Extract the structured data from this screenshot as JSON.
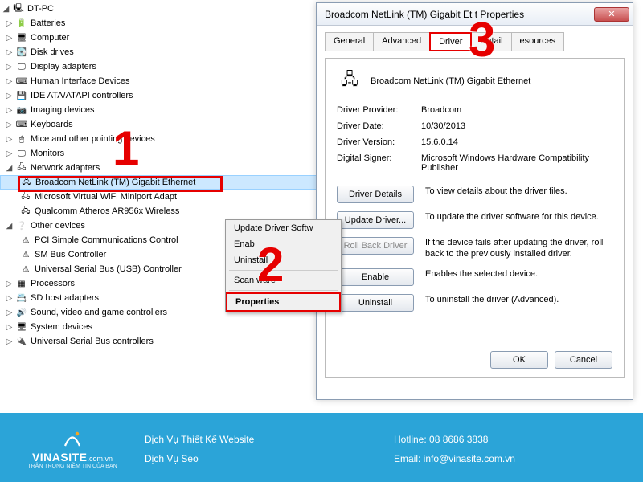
{
  "tree": {
    "root": "DT-PC",
    "items": [
      {
        "icon": "🔋",
        "label": "Batteries"
      },
      {
        "icon": "🖥",
        "label": "Computer"
      },
      {
        "icon": "💽",
        "label": "Disk drives"
      },
      {
        "icon": "🖵",
        "label": "Display adapters"
      },
      {
        "icon": "⌨",
        "label": "Human Interface Devices"
      },
      {
        "icon": "💾",
        "label": "IDE ATA/ATAPI controllers"
      },
      {
        "icon": "📷",
        "label": "Imaging devices"
      },
      {
        "icon": "⌨",
        "label": "Keyboards"
      },
      {
        "icon": "🖱",
        "label": "Mice and other pointing devices"
      },
      {
        "icon": "🖵",
        "label": "Monitors"
      }
    ],
    "network_label": "Network adapters",
    "network_children": [
      "Broadcom NetLink (TM) Gigabit Ethernet",
      "Microsoft Virtual WiFi Miniport Adapt",
      "Qualcomm Atheros AR956x Wireless"
    ],
    "other_label": "Other devices",
    "other_children": [
      "PCI Simple Communications Control",
      "SM Bus Controller",
      "Universal Serial Bus (USB) Controller"
    ],
    "tail": [
      {
        "icon": "▦",
        "label": "Processors"
      },
      {
        "icon": "📇",
        "label": "SD host adapters"
      },
      {
        "icon": "🔊",
        "label": "Sound, video and game controllers"
      },
      {
        "icon": "🖥",
        "label": "System devices"
      },
      {
        "icon": "🔌",
        "label": "Universal Serial Bus controllers"
      }
    ]
  },
  "context_menu": {
    "items": [
      "Update Driver Softw",
      "Enab",
      "Uninstall"
    ],
    "scan": "Scan              ware",
    "properties": "Properties"
  },
  "dialog": {
    "title": "Broadcom NetLink (TM) Gigabit Et          t Properties",
    "tabs": [
      "General",
      "Advanced",
      "Driver",
      "Detail",
      "    esources"
    ],
    "device_name": "Broadcom NetLink (TM) Gigabit Ethernet",
    "info": {
      "provider_label": "Driver Provider:",
      "provider_val": "Broadcom",
      "date_label": "Driver Date:",
      "date_val": "10/30/2013",
      "version_label": "Driver Version:",
      "version_val": "15.6.0.14",
      "signer_label": "Digital Signer:",
      "signer_val": "Microsoft Windows Hardware Compatibility Publisher"
    },
    "buttons": {
      "details": "Driver Details",
      "details_desc": "To view details about the driver files.",
      "update": "Update Driver...",
      "update_desc": "To update the driver software for this device.",
      "rollback": "Roll Back Driver",
      "rollback_desc": "If the device fails after updating the driver, roll back to the previously installed driver.",
      "enable": "Enable",
      "enable_desc": "Enables the selected device.",
      "uninstall": "Uninstall",
      "uninstall_desc": "To uninstall the driver (Advanced).",
      "ok": "OK",
      "cancel": "Cancel"
    }
  },
  "annotations": {
    "a1": "1",
    "a2": "2",
    "a3": "3"
  },
  "footer": {
    "brand": "VINASITE",
    "brand_suffix": ".com.vn",
    "tagline": "TRÂN TRỌNG NIỀM TIN CỦA BẠN",
    "svc1": "Dịch Vụ Thiết Kế Website",
    "svc2": "Dịch Vụ Seo",
    "hotline": "Hotline: 08 8686 3838",
    "email": "Email: info@vinasite.com.vn"
  }
}
